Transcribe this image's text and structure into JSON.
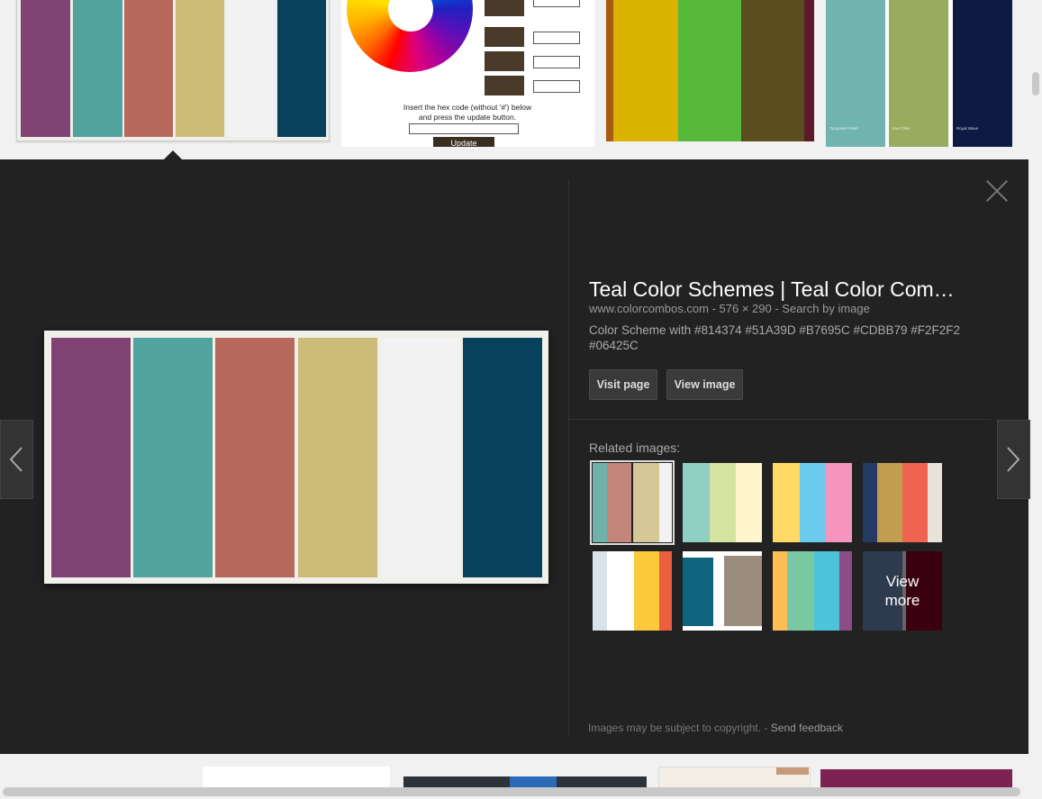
{
  "thumbnails_top": [
    {
      "colors": [
        "#814374",
        "#51A39D",
        "#B7695C",
        "#CDBB79",
        "#F2F2F2",
        "#06425C"
      ]
    },
    {
      "instruction_line1": "Insert the hex code (without '#') below",
      "instruction_line2": "and press the update button.",
      "update_label": "Update"
    },
    {
      "colors": [
        "#A85A0E",
        "#D9B300",
        "#56B93A",
        "#5A4E1E",
        "#5C1A2A"
      ]
    },
    {
      "colors": [
        "#6FB4AF",
        "#98AC5F",
        "#0E1A44"
      ],
      "labels": [
        "Turquoise Pearl",
        "Jive Olive",
        "Royal Wave"
      ]
    }
  ],
  "detail": {
    "title": "Teal Color Schemes | Teal Color Com…",
    "domain": "www.colorcombos.com",
    "size": "576 × 290",
    "search_by_image": "Search by image",
    "description": "Color Scheme with #814374 #51A39D #B7695C #CDBB79 #F2F2F2 #06425C",
    "visit_page": "Visit page",
    "view_image": "View image",
    "related_label": "Related images:",
    "view_more": "View more",
    "copyright": "Images may be subject to copyright.",
    "send_feedback": "Send feedback",
    "main_colors": [
      "#814374",
      "#51A39D",
      "#B7695C",
      "#CDBB79",
      "#F2F2F2",
      "#06425C"
    ]
  },
  "related": [
    [
      "#6FB2A9",
      "#C2877A",
      "#D5C796",
      "#F2F2F2"
    ],
    [
      "#8FD0C3",
      "#D4E3A0",
      "#FFF6CE"
    ],
    [
      "#FFD965",
      "#6DCAEF",
      "#F595BE"
    ],
    [
      "#243A64",
      "#C19E4F",
      "#EE6450",
      "#E8E3DA"
    ],
    [
      "#D8E3EA",
      "#FFFFFF",
      "#FCC93A",
      "#EB5E3E"
    ],
    [
      "#0E6580",
      "#FFFFFF",
      "#9A8D7D"
    ],
    [
      "#FDBE52",
      "#79C8A4",
      "#4CC3D8",
      "#8C4C84"
    ],
    [
      "#2E3B4E",
      "#3A0010"
    ]
  ],
  "colors": {
    "panel_bg": "#222222",
    "page_bg": "#F1F1F1"
  },
  "icons": [
    "close-icon",
    "chevron-left-icon",
    "chevron-right-icon"
  ]
}
